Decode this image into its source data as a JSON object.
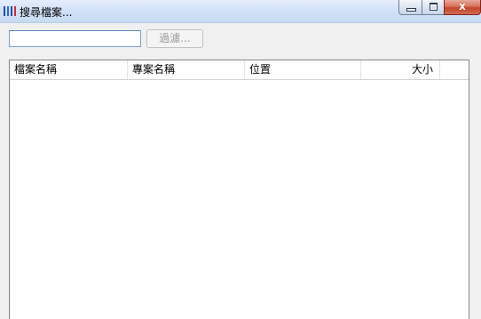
{
  "window": {
    "title": "搜尋檔案...",
    "close_glyph": "x"
  },
  "icon_colors": [
    "#1f4fb8",
    "#2f6ad8",
    "#1f4fb8",
    "#d42a2a"
  ],
  "filter": {
    "input_value": "",
    "button_label": "過濾..."
  },
  "table": {
    "columns": [
      "檔案名稱",
      "專案名稱",
      "位置",
      "大小"
    ],
    "rows": []
  }
}
